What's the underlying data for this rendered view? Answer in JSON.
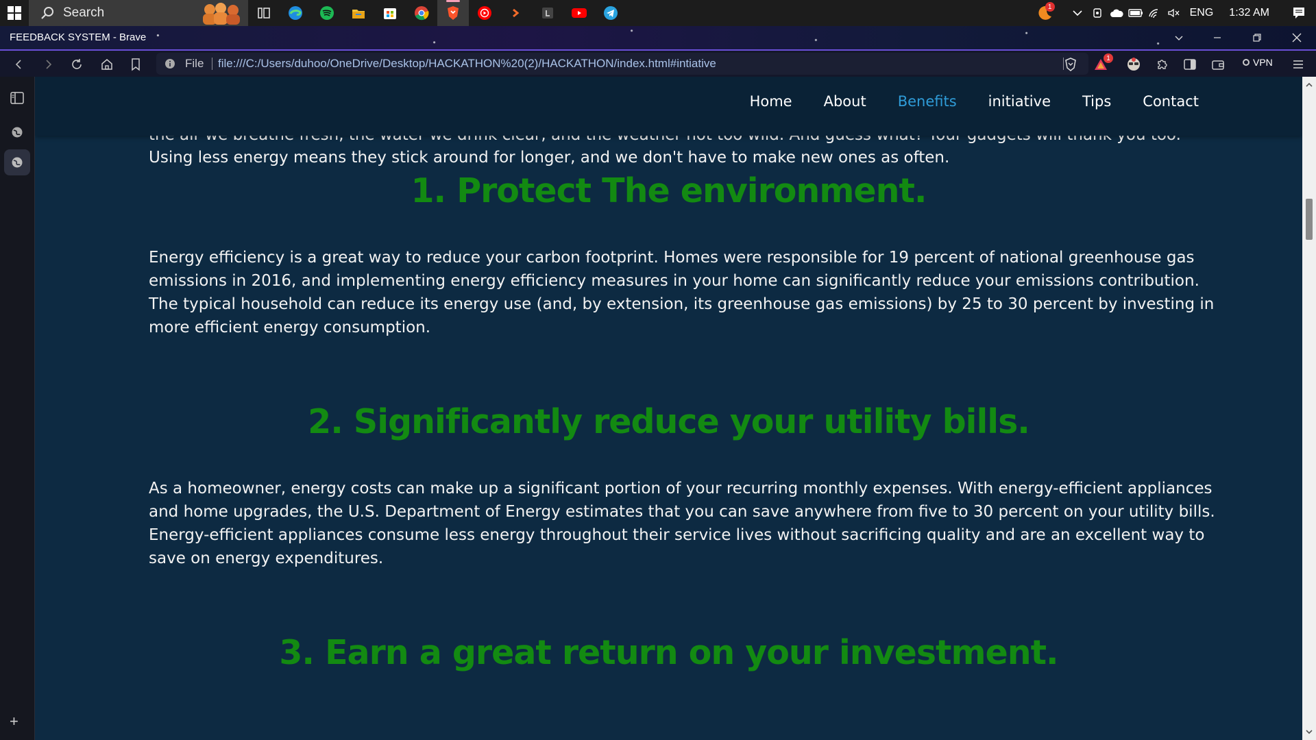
{
  "taskbar": {
    "search_placeholder": "Search",
    "tray": {
      "language": "ENG",
      "time": "1:32 AM",
      "notification_count": "1"
    }
  },
  "browser": {
    "window_title": "FEEDBACK SYSTEM - Brave",
    "url_scheme": "File",
    "url": "file:///C:/Users/duhoo/OneDrive/Desktop/HACKATHON%20(2)/HACKATHON/index.html#intiative",
    "shields_badge": "1",
    "vpn_label": "VPN"
  },
  "site": {
    "nav": [
      {
        "label": "Home"
      },
      {
        "label": "About"
      },
      {
        "label": "Benefits"
      },
      {
        "label": "initiative"
      },
      {
        "label": "Tips"
      },
      {
        "label": "Contact"
      }
    ],
    "active_nav": "Benefits",
    "intro_partial_line": "the air we breathe fresh, the water we drink clear, and the weather not too wild. And guess what? Your gadgets will thank you too.",
    "intro_last_line": "Using less energy means they stick around for longer, and we don't have to make new ones as often.",
    "sections": [
      {
        "heading": "1. Protect The environment.",
        "body": "Energy efficiency is a great way to reduce your carbon footprint. Homes were responsible for 19 percent of national greenhouse gas emissions in 2016, and implementing energy efficiency measures in your home can significantly reduce your emissions contribution. The typical household can reduce its energy use (and, by extension, its greenhouse gas emissions) by 25 to 30 percent by investing in more efficient energy consumption."
      },
      {
        "heading": "2. Significantly reduce your utility bills.",
        "body": "As a homeowner, energy costs can make up a significant portion of your recurring monthly expenses. With energy-efficient appliances and home upgrades, the U.S. Department of Energy estimates that you can save anywhere from five to 30 percent on your utility bills. Energy-efficient appliances consume less energy throughout their service lives without sacrificing quality and are an excellent way to save on energy expenditures."
      },
      {
        "heading": "3. Earn a great return on your investment."
      }
    ]
  },
  "colors": {
    "heading_green": "#138a12",
    "nav_active": "#2f9cd8",
    "page_bg": "#0d2a42"
  }
}
